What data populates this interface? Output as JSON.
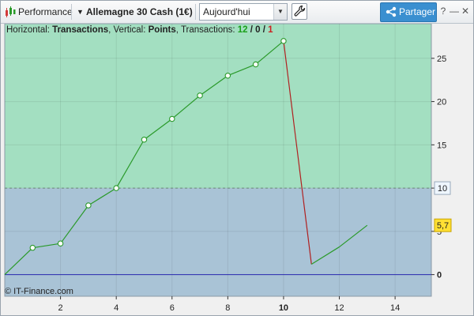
{
  "toolbar": {
    "performance_label": "Performance",
    "instrument_label": "Allemagne 30 Cash (1€)",
    "period_value": "Aujourd'hui",
    "share_label": "Partager"
  },
  "info": {
    "horizontal_prefix": "Horizontal: ",
    "horizontal_value": "Transactions",
    "vertical_prefix": ", Vertical: ",
    "vertical_value": "Points",
    "transactions_prefix": ", Transactions: ",
    "transactions_win": "12",
    "sep1": " / ",
    "transactions_neutral": "0",
    "sep2": " / ",
    "transactions_loss": "1"
  },
  "copyright": "© IT-Finance.com",
  "colors": {
    "gain_zone": "#a3dfc1",
    "loss_zone": "#a9c3d6",
    "gain_line": "#2a9a2a",
    "loss_line": "#b02020",
    "zero_line": "#2a2ab0",
    "win_count": "#1aa01a",
    "loss_count": "#cc2020",
    "last_value_badge": "#ffe033"
  },
  "chart_data": {
    "type": "line",
    "xlabel": "Transactions",
    "ylabel": "Points",
    "xlim": [
      0,
      15.3
    ],
    "ylim": [
      -2.5,
      29
    ],
    "x_ticks": [
      2,
      4,
      6,
      8,
      10,
      12,
      14
    ],
    "x_tick_labels": [
      "2",
      "4",
      "6",
      "8",
      "10",
      "12",
      "14"
    ],
    "y_ticks": [
      0,
      5,
      10,
      15,
      20,
      25
    ],
    "y_tick_labels": [
      "0",
      "5",
      "10",
      "15",
      "20",
      "25"
    ],
    "threshold_value": 10,
    "threshold_label": "10",
    "last_value_label": "5,7",
    "series": [
      {
        "x": [
          0,
          1,
          2,
          3,
          4,
          5,
          6,
          7,
          8,
          9,
          10,
          11,
          12,
          13
        ],
        "y": [
          0,
          3.1,
          3.6,
          8.0,
          10.0,
          15.6,
          18.0,
          20.7,
          23.0,
          24.3,
          27.0,
          1.2,
          3.2,
          5.7
        ],
        "segment_colors": [
          "gain",
          "gain",
          "gain",
          "gain",
          "gain",
          "gain",
          "gain",
          "gain",
          "gain",
          "gain",
          "loss",
          "gain",
          "gain"
        ],
        "markers_until_index": 10
      }
    ],
    "grid": true
  }
}
